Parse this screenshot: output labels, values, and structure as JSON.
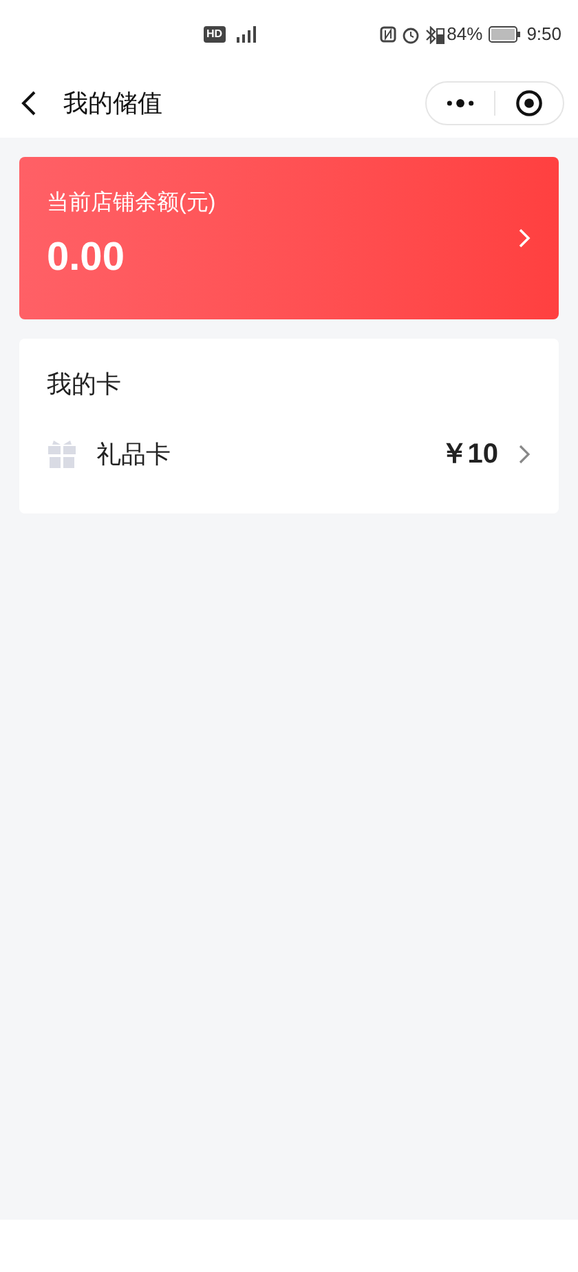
{
  "status_bar": {
    "badge": "HD",
    "battery": "84%",
    "time": "9:50"
  },
  "nav": {
    "title": "我的储值"
  },
  "balance": {
    "label": "当前店铺余额(元)",
    "amount": "0.00"
  },
  "cards": {
    "title": "我的卡",
    "items": [
      {
        "name": "礼品卡",
        "amount": "￥10"
      }
    ]
  }
}
